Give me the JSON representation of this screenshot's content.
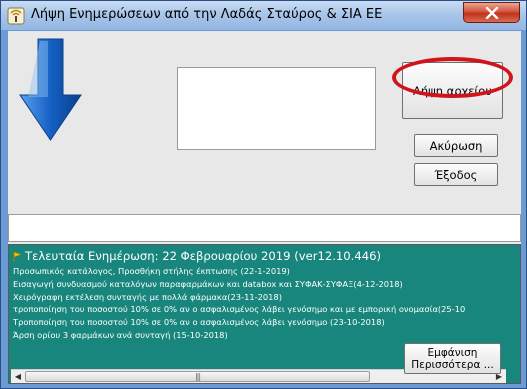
{
  "window": {
    "title": "Λήψη Ενημερώσεων από την Λαδάς Σταύρος & ΣΙΑ ΕΕ"
  },
  "icons": {
    "app": "antenna-icon",
    "close": "close-icon",
    "arrow": "download-arrow-icon",
    "flag": "flag-icon"
  },
  "buttons": {
    "get_file": "Λήψη αρχείου",
    "cancel": "Ακύρωση",
    "exit": "Έξοδος",
    "show_more_line1": "Εμφάνιση",
    "show_more_line2": "Περισσότερα ..."
  },
  "news": {
    "title": "Τελευταία Ενημέρωση: 22 Φεβρουαρίου 2019 (ver12.10.446)",
    "items": [
      "Προσωπικός κατάλογος, Προσθήκη στήλης έκπτωσης (22-1-2019)",
      "Εισαγωγή συνδυασμού καταλόγων παραφαρμάκων και databox και ΣΥΦΑΚ-ΣΥΦΑΞ(4-12-2018)",
      "Χειρόγραφη εκτέλεση συνταγής με πολλά φάρμακα(23-11-2018)",
      "τροποποίηση του ποσοστού 10% σε 0% αν ο ασφαλισμένος λάβει γενόσημο και με εμπορική ονομασία(25-10",
      "Τροποποίηση του ποσοστού 10% σε 0% αν ο ασφαλισμένος λάβει γενόσημο (23-10-2018)",
      "Άρση ορίου 3 φαρμάκων ανά συνταγή (15-10-2018)"
    ]
  },
  "colors": {
    "title_bar": "#a9c6ea",
    "close_button": "#c8432c",
    "news_background": "#18867c",
    "highlight_ring": "#d1141c",
    "arrow_blue": "#1560c4"
  }
}
